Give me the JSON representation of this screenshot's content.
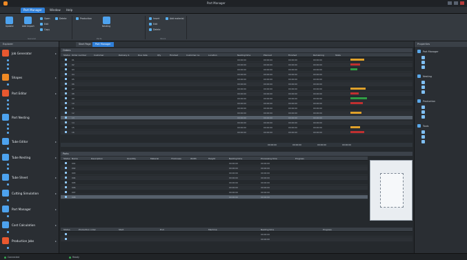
{
  "window": {
    "title": "Part Manager"
  },
  "menu": {
    "tabs": [
      "Part Manager",
      "Window",
      "Help"
    ]
  },
  "ribbon": {
    "buttons": [
      {
        "label": "Update",
        "color": "#4da2ee"
      },
      {
        "label": "Add Import",
        "color": "#4da2ee"
      },
      {
        "label": "Nesting",
        "color": "#4da2ee"
      }
    ],
    "small": [
      {
        "label": "Open",
        "color": "#58b0f0"
      },
      {
        "label": "Edit",
        "color": "#58b0f0"
      },
      {
        "label": "Copy",
        "color": "#58b0f0"
      },
      {
        "label": "Delete",
        "color": "#58b0f0"
      },
      {
        "label": "Production",
        "color": "#58b0f0"
      },
      {
        "label": "Insert",
        "color": "#58b0f0"
      },
      {
        "label": "Edit",
        "color": "#58b0f0"
      },
      {
        "label": "Delete",
        "color": "#58b0f0"
      },
      {
        "label": "Add material",
        "color": "#58b0f0"
      }
    ],
    "groups": [
      "General",
      "Parts",
      "Stock"
    ]
  },
  "leftnav": {
    "header": "Explorer",
    "items": [
      {
        "label": "Job Generator",
        "color": "#e8582f"
      },
      {
        "label": "Shapes",
        "color": "#f08a24"
      },
      {
        "label": "Part Editor",
        "color": "#e8582f"
      },
      {
        "label": "Part Nesting",
        "color": "#4da2ee"
      },
      {
        "label": "Tube Editor",
        "color": "#4da2ee"
      },
      {
        "label": "Tube Nesting",
        "color": "#4da2ee"
      },
      {
        "label": "Tube Sheet",
        "color": "#4da2ee"
      },
      {
        "label": "Cutting Simulation",
        "color": "#4da2ee"
      },
      {
        "label": "Part Manager",
        "color": "#4da2ee"
      },
      {
        "label": "Cost Calculation",
        "color": "#4da2ee"
      },
      {
        "label": "Production Jobs",
        "color": "#e8582f"
      }
    ]
  },
  "doctabs": [
    "Start Page",
    "Part Manager"
  ],
  "central": {
    "upper_caption": "Orders",
    "upper_headers": [
      "Status",
      "Order number",
      "Customer",
      "Delivery d.",
      "Due date",
      "Qty",
      "Finished",
      "Customer no.",
      "Location",
      "Nesting time",
      "Planned",
      "Finished",
      "Remaining",
      "State"
    ],
    "upper_rows": [
      {
        "cells": [
          "",
          "01",
          "",
          "",
          "",
          "",
          "",
          "",
          "",
          "00:00:00",
          "00:00:00",
          "00:00:00",
          "00:00:00",
          ""
        ],
        "bar": "#e0a12a",
        "barw": 20
      },
      {
        "cells": [
          "",
          "02",
          "",
          "",
          "",
          "",
          "",
          "",
          "",
          "00:00:00",
          "00:00:00",
          "00:00:00",
          "00:00:00",
          ""
        ],
        "bar": "#c03030",
        "barw": 14
      },
      {
        "cells": [
          "",
          "03",
          "",
          "",
          "",
          "",
          "",
          "",
          "",
          "00:00:00",
          "00:00:00",
          "00:00:00",
          "00:00:00",
          ""
        ],
        "bar": "#2f9e44",
        "barw": 10
      },
      {
        "cells": [
          "",
          "04",
          "",
          "",
          "",
          "",
          "",
          "",
          "",
          "00:00:00",
          "00:00:00",
          "00:00:00",
          "00:00:00",
          ""
        ],
        "bar": "",
        "barw": 0
      },
      {
        "cells": [
          "",
          "05",
          "",
          "",
          "",
          "",
          "",
          "",
          "",
          "00:00:00",
          "00:00:00",
          "00:00:00",
          "00:00:00",
          ""
        ],
        "bar": "",
        "barw": 0
      },
      {
        "cells": [
          "",
          "06",
          "",
          "",
          "",
          "",
          "",
          "",
          "",
          "00:00:00",
          "00:00:00",
          "00:00:00",
          "00:00:00",
          ""
        ],
        "bar": "",
        "barw": 0
      },
      {
        "cells": [
          "",
          "07",
          "",
          "",
          "",
          "",
          "",
          "",
          "",
          "00:00:00",
          "00:00:00",
          "00:00:00",
          "00:00:00",
          ""
        ],
        "bar": "#e0a12a",
        "barw": 22
      },
      {
        "cells": [
          "",
          "08",
          "",
          "",
          "",
          "",
          "",
          "",
          "",
          "00:00:00",
          "00:00:00",
          "00:00:00",
          "00:00:00",
          ""
        ],
        "bar": "#c03030",
        "barw": 12
      },
      {
        "cells": [
          "",
          "09",
          "",
          "",
          "",
          "",
          "",
          "",
          "",
          "00:00:00",
          "00:00:00",
          "00:00:00",
          "00:00:00",
          ""
        ],
        "bar": "#2f9e44",
        "barw": 24
      },
      {
        "cells": [
          "",
          "10",
          "",
          "",
          "",
          "",
          "",
          "",
          "",
          "00:00:00",
          "00:00:00",
          "00:00:00",
          "00:00:00",
          ""
        ],
        "bar": "#c03030",
        "barw": 18
      },
      {
        "cells": [
          "",
          "11",
          "",
          "",
          "",
          "",
          "",
          "",
          "",
          "00:00:00",
          "00:00:00",
          "00:00:00",
          "00:00:00",
          ""
        ],
        "bar": "",
        "barw": 0
      },
      {
        "cells": [
          "",
          "12",
          "",
          "",
          "",
          "",
          "",
          "",
          "",
          "00:00:00",
          "00:00:00",
          "00:00:00",
          "00:00:00",
          ""
        ],
        "bar": "#e0a12a",
        "barw": 16
      },
      {
        "cells": [
          "",
          "13",
          "",
          "",
          "",
          "",
          "",
          "",
          "",
          "00:00:00",
          "00:00:00",
          "00:00:00",
          "00:00:00",
          ""
        ],
        "bar": "",
        "barw": 0
      },
      {
        "cells": [
          "",
          "14",
          "",
          "",
          "",
          "",
          "",
          "",
          "",
          "00:00:00",
          "00:00:00",
          "00:00:00",
          "00:00:00",
          ""
        ],
        "bar": "",
        "barw": 0
      },
      {
        "cells": [
          "",
          "15",
          "",
          "",
          "",
          "",
          "",
          "",
          "",
          "00:00:00",
          "00:00:00",
          "00:00:00",
          "00:00:00",
          ""
        ],
        "bar": "#e0a12a",
        "barw": 14
      },
      {
        "cells": [
          "",
          "16",
          "",
          "",
          "",
          "",
          "",
          "",
          "",
          "00:00:00",
          "00:00:00",
          "00:00:00",
          "00:00:00",
          ""
        ],
        "bar": "#c03030",
        "barw": 20
      }
    ],
    "upper_totals": [
      "00:00:00",
      "00:00:00",
      "00:00:00",
      "00:00:00"
    ],
    "lower_caption": "Parts",
    "lower_headers": [
      "Status",
      "Name",
      "Description",
      "Quantity",
      "Material",
      "Thickness",
      "Width",
      "Height",
      "Nesting time",
      "Processing time",
      "Progress"
    ],
    "lower_rows": [
      {
        "cells": [
          "",
          "001",
          "",
          "",
          "",
          "",
          "",
          "",
          "00:00:00",
          "00:00:00",
          ""
        ]
      },
      {
        "cells": [
          "",
          "002",
          "",
          "",
          "",
          "",
          "",
          "",
          "00:00:00",
          "00:00:00",
          ""
        ]
      },
      {
        "cells": [
          "",
          "003",
          "",
          "",
          "",
          "",
          "",
          "",
          "00:00:00",
          "00:00:00",
          ""
        ]
      },
      {
        "cells": [
          "",
          "004",
          "",
          "",
          "",
          "",
          "",
          "",
          "00:00:00",
          "00:00:00",
          ""
        ]
      },
      {
        "cells": [
          "",
          "005",
          "",
          "",
          "",
          "",
          "",
          "",
          "00:00:00",
          "00:00:00",
          ""
        ]
      },
      {
        "cells": [
          "",
          "006",
          "",
          "",
          "",
          "",
          "",
          "",
          "00:00:00",
          "00:00:00",
          ""
        ]
      },
      {
        "cells": [
          "",
          "007",
          "",
          "",
          "",
          "",
          "",
          "",
          "00:00:00",
          "00:00:00",
          ""
        ]
      },
      {
        "cells": [
          "",
          "008",
          "",
          "",
          "",
          "",
          "",
          "",
          "00:00:00",
          "00:00:00",
          ""
        ]
      }
    ],
    "bottom_headers": [
      "Status",
      "Production order",
      "Start",
      "End",
      "Machine",
      "Nesting time",
      "Progress"
    ],
    "bottom_rows": [
      {
        "cells": [
          "",
          "",
          "",
          "",
          "",
          "00:00:00",
          ""
        ]
      },
      {
        "cells": [
          "",
          "",
          "",
          "",
          "",
          "00:00:00",
          ""
        ]
      }
    ]
  },
  "rightpanel": {
    "header": "Properties",
    "items": [
      {
        "label": "Part Manager",
        "section": true
      },
      {
        "label": "Nesting",
        "section": true
      },
      {
        "label": "Production",
        "section": true
      },
      {
        "label": "Tools",
        "section": true
      }
    ]
  },
  "statusbar": {
    "left": "Connected",
    "middle": "Ready"
  }
}
